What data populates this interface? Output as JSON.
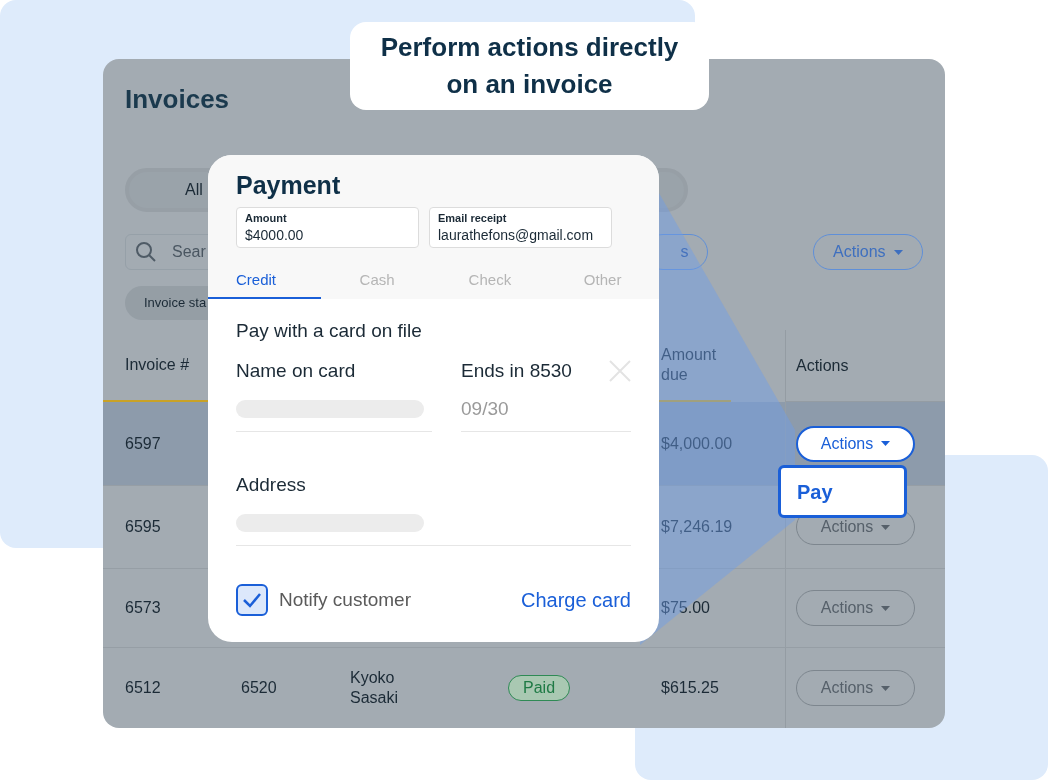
{
  "callout": "Perform actions directly on an invoice",
  "invoices": {
    "title": "Invoices",
    "filter_pill": "All",
    "search": {
      "placeholder": "Sear"
    },
    "partial_button": "s",
    "actions_button": "Actions",
    "status_chip": "Invoice sta",
    "table": {
      "columns": {
        "invoice": "Invoice #",
        "amount_due": "Amount due",
        "actions": "Actions"
      },
      "rows": [
        {
          "invoice": "6597",
          "amount_due": "$4,000.00",
          "action": "Actions",
          "selected": true,
          "disabled": false
        },
        {
          "invoice": "6595",
          "amount_due": "$7,246.19",
          "action": "Actions",
          "selected": false,
          "disabled": true
        },
        {
          "invoice": "6573",
          "amount_due": "$75.00",
          "action": "Actions",
          "selected": false,
          "disabled": true
        },
        {
          "invoice": "6512",
          "column_2": "6520",
          "column_3": "Kyoko Sasaki",
          "status": "Paid",
          "amount_due": "$615.25",
          "action": "Actions",
          "selected": false,
          "disabled": true
        }
      ]
    }
  },
  "actions_menu": {
    "items": [
      "Pay"
    ]
  },
  "payment_dialog": {
    "title": "Payment",
    "fields": [
      {
        "label": "Amount",
        "value": "$4000.00"
      },
      {
        "label": "Email receipt",
        "value": "laurathefons@gmail.com"
      }
    ],
    "tabs": [
      {
        "label": "Credit",
        "selected": true
      },
      {
        "label": "Cash",
        "selected": false
      },
      {
        "label": "Check",
        "selected": false
      },
      {
        "label": "Other",
        "selected": false
      }
    ],
    "section_title": "Pay with a card on file",
    "name_label": "Name on card",
    "card_label": "Ends in 8530",
    "expiry": "09/30",
    "address_label": "Address",
    "notify": {
      "label": "Notify customer",
      "checked": true
    },
    "charge_button": "Charge card"
  }
}
